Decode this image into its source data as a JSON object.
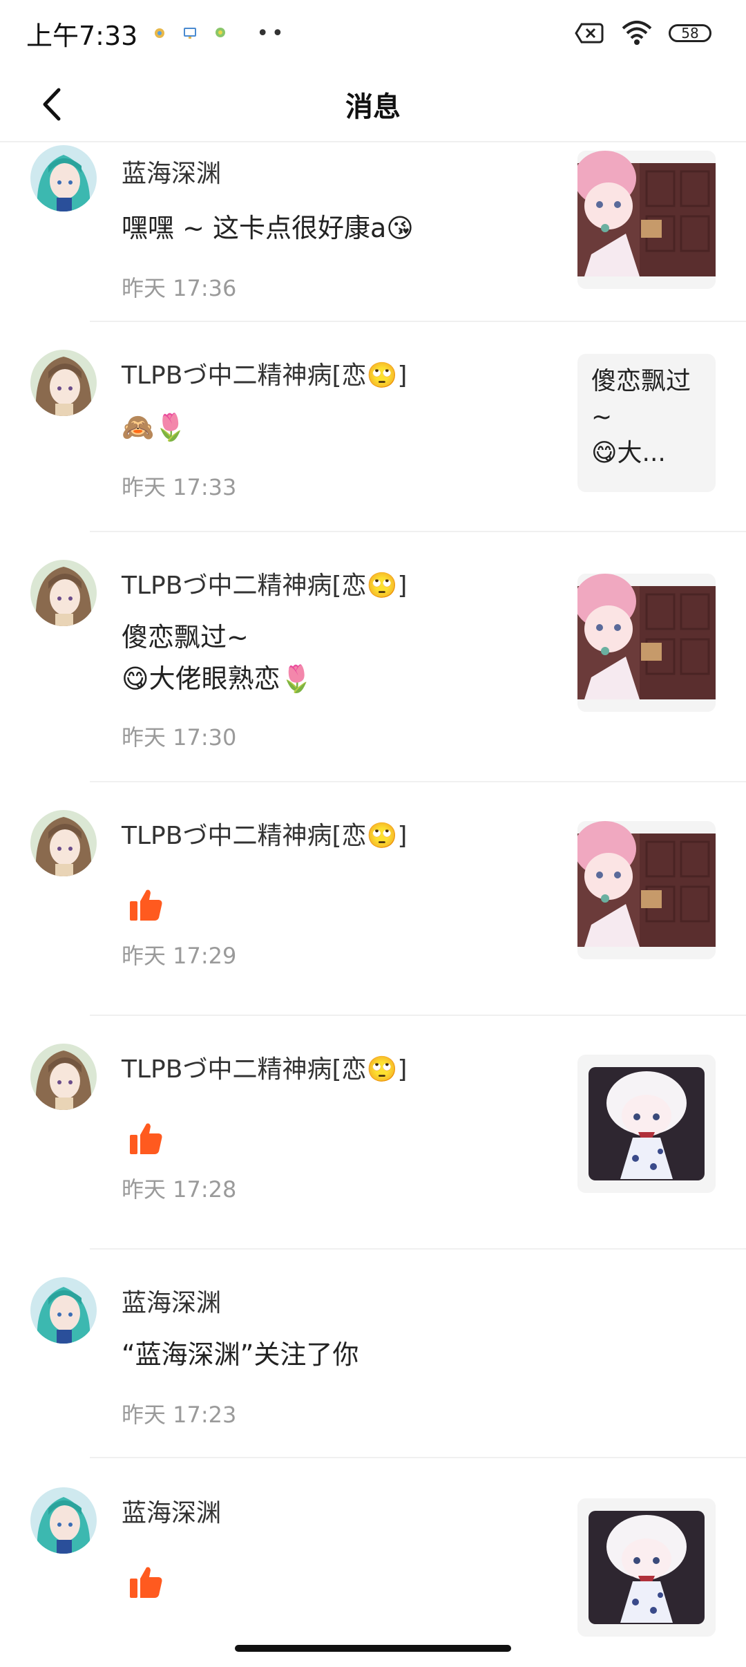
{
  "status_bar": {
    "time": "上午7:33",
    "dots": "••",
    "battery": "58"
  },
  "header": {
    "title": "消息"
  },
  "messages": [
    {
      "name": "蓝海深渊",
      "text": "嘿嘿 ~ 这卡点很好康a😘",
      "time": "昨天 17:36",
      "avatar": "teal-hair-avatar",
      "thumb": "pink-hair-video-thumbnail"
    },
    {
      "name": "TLPBづ中二精神病[恋🙄]",
      "text": "🙈🌷",
      "time": "昨天 17:33",
      "avatar": "brown-hair-avatar",
      "thumb_text": "傻恋飘过\n~\n😋大..."
    },
    {
      "name": "TLPBづ中二精神病[恋🙄]",
      "text": "傻恋飘过~\n😋大佬眼熟恋🌷",
      "time": "昨天 17:30",
      "avatar": "brown-hair-avatar",
      "thumb": "pink-hair-video-thumbnail"
    },
    {
      "name": "TLPBづ中二精神病[恋🙄]",
      "like": true,
      "time": "昨天 17:29",
      "avatar": "brown-hair-avatar",
      "thumb": "pink-hair-video-thumbnail"
    },
    {
      "name": "TLPBづ中二精神病[恋🙄]",
      "like": true,
      "time": "昨天 17:28",
      "avatar": "brown-hair-avatar",
      "thumb": "white-hair-doll-thumbnail"
    },
    {
      "name": "蓝海深渊",
      "text": "“蓝海深渊”关注了你",
      "time": "昨天 17:23",
      "avatar": "teal-hair-avatar"
    },
    {
      "name": "蓝海深渊",
      "like": true,
      "avatar": "teal-hair-avatar",
      "thumb": "white-hair-doll-thumbnail"
    }
  ],
  "colors": {
    "like": "#ff5a1f",
    "time": "#9a9a9a",
    "divider": "#f0f0f0",
    "thumb_bg": "#f4f4f4"
  }
}
